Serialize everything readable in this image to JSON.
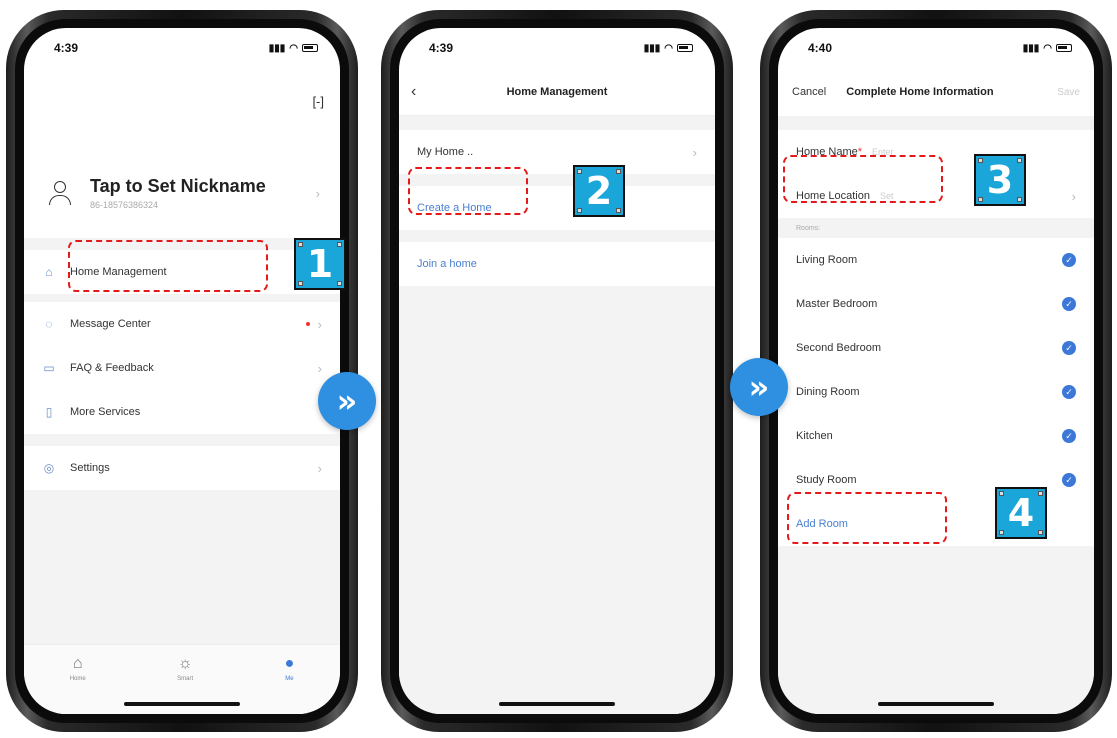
{
  "phone1": {
    "time": "4:39",
    "scan_glyph": "[-]",
    "profile": {
      "name": "Tap to Set Nickname",
      "phone": "86-18576386324"
    },
    "menu": [
      {
        "label": "Home Management",
        "icon": "home-icon"
      },
      {
        "label": "Message Center",
        "icon": "message-icon"
      },
      {
        "label": "FAQ & Feedback",
        "icon": "faq-icon"
      },
      {
        "label": "More Services",
        "icon": "bookmark-icon"
      },
      {
        "label": "Settings",
        "icon": "settings-icon"
      }
    ],
    "tabs": [
      {
        "label": "Home",
        "icon": "home-tab-icon"
      },
      {
        "label": "Smart",
        "icon": "smart-tab-icon"
      },
      {
        "label": "Me",
        "icon": "me-tab-icon"
      }
    ]
  },
  "phone2": {
    "time": "4:39",
    "title": "Home Management",
    "items": [
      {
        "label": "My Home .."
      },
      {
        "label": "Create a Home"
      },
      {
        "label": "Join a home"
      }
    ]
  },
  "phone3": {
    "time": "4:40",
    "cancel": "Cancel",
    "title": "Complete Home Information",
    "save": "Save",
    "home_name_label": "Home Name",
    "home_name_required": "*",
    "home_name_placeholder": "Enter",
    "home_location_label": "Home Location",
    "home_location_placeholder": "Set",
    "rooms_label": "Rooms:",
    "rooms": [
      "Living Room",
      "Master Bedroom",
      "Second Bedroom",
      "Dining Room",
      "Kitchen",
      "Study Room"
    ],
    "add_room": "Add Room"
  },
  "steps": [
    "1",
    "2",
    "3",
    "4"
  ],
  "colors": {
    "accent": "#3c78d8",
    "annotation": "#e41a1a",
    "step_badge": "#1aa6d9"
  }
}
